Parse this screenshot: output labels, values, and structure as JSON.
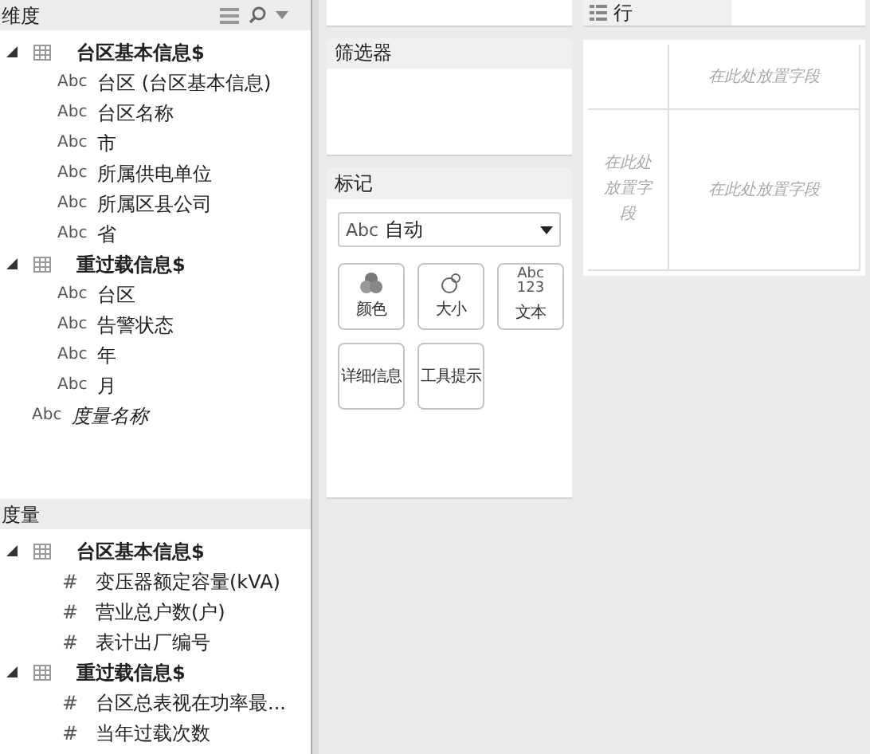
{
  "dimensions": {
    "title": "维度",
    "tools": [
      {
        "kind": "list"
      },
      {
        "kind": "search"
      },
      {
        "kind": "menu"
      }
    ],
    "items": [
      {
        "kind": "table",
        "label": "台区基本信息$",
        "expanded": true,
        "children": [
          {
            "kind": "field",
            "type_text": "Abc",
            "label": "台区 (台区基本信息)",
            "italic": false
          },
          {
            "kind": "field",
            "type_text": "Abc",
            "label": "台区名称",
            "italic": false
          },
          {
            "kind": "field",
            "type_text": "Abc",
            "label": "市",
            "italic": false
          },
          {
            "kind": "field",
            "type_text": "Abc",
            "label": "所属供电单位",
            "italic": false
          },
          {
            "kind": "field",
            "type_text": "Abc",
            "label": "所属区县公司",
            "italic": false
          },
          {
            "kind": "field",
            "type_text": "Abc",
            "label": "省",
            "italic": false
          }
        ]
      },
      {
        "kind": "table",
        "label": "重过载信息$",
        "expanded": true,
        "children": [
          {
            "kind": "field",
            "type_text": "Abc",
            "label": "台区",
            "italic": false
          },
          {
            "kind": "field",
            "type_text": "Abc",
            "label": "告警状态",
            "italic": false
          },
          {
            "kind": "field",
            "type_text": "Abc",
            "label": "年",
            "italic": false
          },
          {
            "kind": "field",
            "type_text": "Abc",
            "label": "月",
            "italic": false
          }
        ]
      },
      {
        "kind": "field",
        "type_text": "Abc",
        "label": "度量名称",
        "italic": true
      }
    ]
  },
  "measures": {
    "title": "度量",
    "items": [
      {
        "kind": "table",
        "label": "台区基本信息$",
        "expanded": true,
        "children": [
          {
            "kind": "field",
            "type_text": "#",
            "label": "变压器额定容量(kVA)",
            "italic": false
          },
          {
            "kind": "field",
            "type_text": "#",
            "label": "营业总户数(户)",
            "italic": false
          },
          {
            "kind": "field",
            "type_text": "#",
            "label": "表计出厂编号",
            "italic": false
          }
        ]
      },
      {
        "kind": "table",
        "label": "重过载信息$",
        "expanded": true,
        "children": [
          {
            "kind": "field",
            "type_text": "#",
            "label": "台区总表视在功率最...",
            "italic": false
          },
          {
            "kind": "field",
            "type_text": "#",
            "label": "当年过载次数",
            "italic": false
          }
        ]
      }
    ]
  },
  "filters": {
    "title": "筛选器"
  },
  "marks": {
    "title": "标记",
    "mark_type": {
      "prefix": "Abc",
      "value": "自动"
    },
    "buttons": [
      {
        "kind": "color",
        "label": "颜色"
      },
      {
        "kind": "size",
        "label": "大小"
      },
      {
        "kind": "text",
        "label": "文本",
        "icon_text": [
          "Abc",
          "123"
        ]
      },
      {
        "kind": "detail",
        "label": "详细信息"
      },
      {
        "kind": "tooltip",
        "label": "工具提示"
      }
    ]
  },
  "rows_shelf": {
    "label": "行"
  },
  "view": {
    "placeholders": [
      "在此处放置字段",
      "在此处放置字段",
      "在此处放置字段"
    ]
  }
}
